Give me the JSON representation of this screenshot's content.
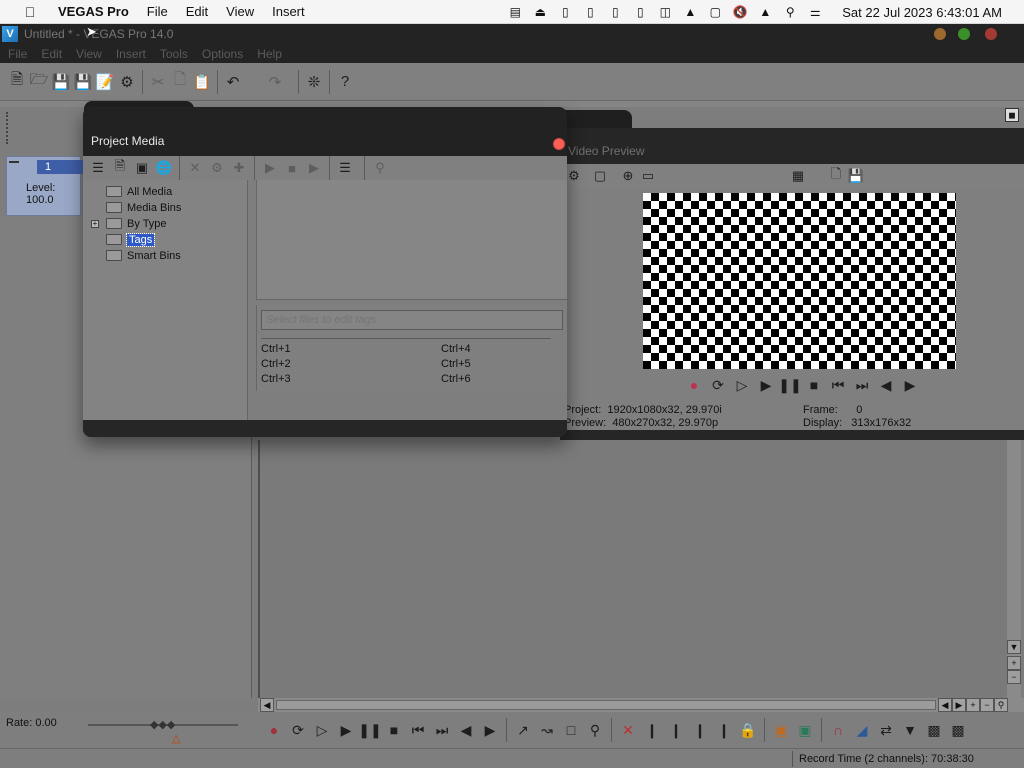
{
  "menubar": {
    "app_name": "VEGAS Pro",
    "items": [
      "File",
      "Edit",
      "View",
      "Insert"
    ],
    "clock": "Sat 22 Jul 2023  6:43:01 AM"
  },
  "window": {
    "title": "Untitled * - VEGAS Pro 14.0",
    "logo_letter": "V",
    "menu": [
      "File",
      "Edit",
      "View",
      "Insert",
      "Tools",
      "Options",
      "Help"
    ]
  },
  "track": {
    "number": "1",
    "level": "Level: 100.0"
  },
  "project_media": {
    "title": "Project Media",
    "tree": [
      {
        "label": "All Media"
      },
      {
        "label": "Media Bins"
      },
      {
        "label": "By Type",
        "expander": "+"
      },
      {
        "label": "Tags",
        "selected": true
      },
      {
        "label": "Smart Bins"
      }
    ],
    "tag_placeholder": "Select files to edit tags",
    "hotkeys": [
      "Ctrl+1",
      "Ctrl+2",
      "Ctrl+3",
      "Ctrl+4",
      "Ctrl+5",
      "Ctrl+6"
    ]
  },
  "video_preview": {
    "title": "Video Preview",
    "project_label": "Project:",
    "project_value": "1920x1080x32, 29.970i",
    "preview_label": "Preview:",
    "preview_value": "480x270x32, 29.970p",
    "frame_label": "Frame:",
    "frame_value": "0",
    "display_label": "Display:",
    "display_value": "313x176x32"
  },
  "transport": {
    "rate": "Rate: 0.00"
  },
  "status": {
    "record_time": "Record Time (2 channels): 70:38:30"
  },
  "colors": {
    "accent": "#2c58c8",
    "close": "#ff5f57",
    "minimize": "#9c6a2f",
    "zoom": "#3b8f2a"
  }
}
